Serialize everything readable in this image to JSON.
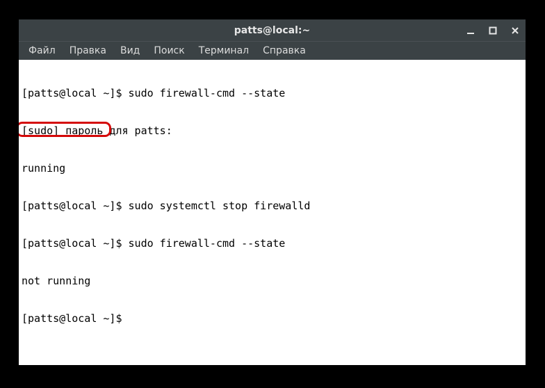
{
  "window": {
    "title": "patts@local:~"
  },
  "menu": {
    "file": "Файл",
    "edit": "Правка",
    "view": "Вид",
    "search": "Поиск",
    "terminal": "Терминал",
    "help": "Справка"
  },
  "terminal": {
    "lines": [
      "[patts@local ~]$ sudo firewall-cmd --state",
      "[sudo] пароль для patts:",
      "running",
      "[patts@local ~]$ sudo systemctl stop firewalld",
      "[patts@local ~]$ sudo firewall-cmd --state",
      "not running",
      "[patts@local ~]$ "
    ]
  },
  "highlight": {
    "text": "not running"
  }
}
